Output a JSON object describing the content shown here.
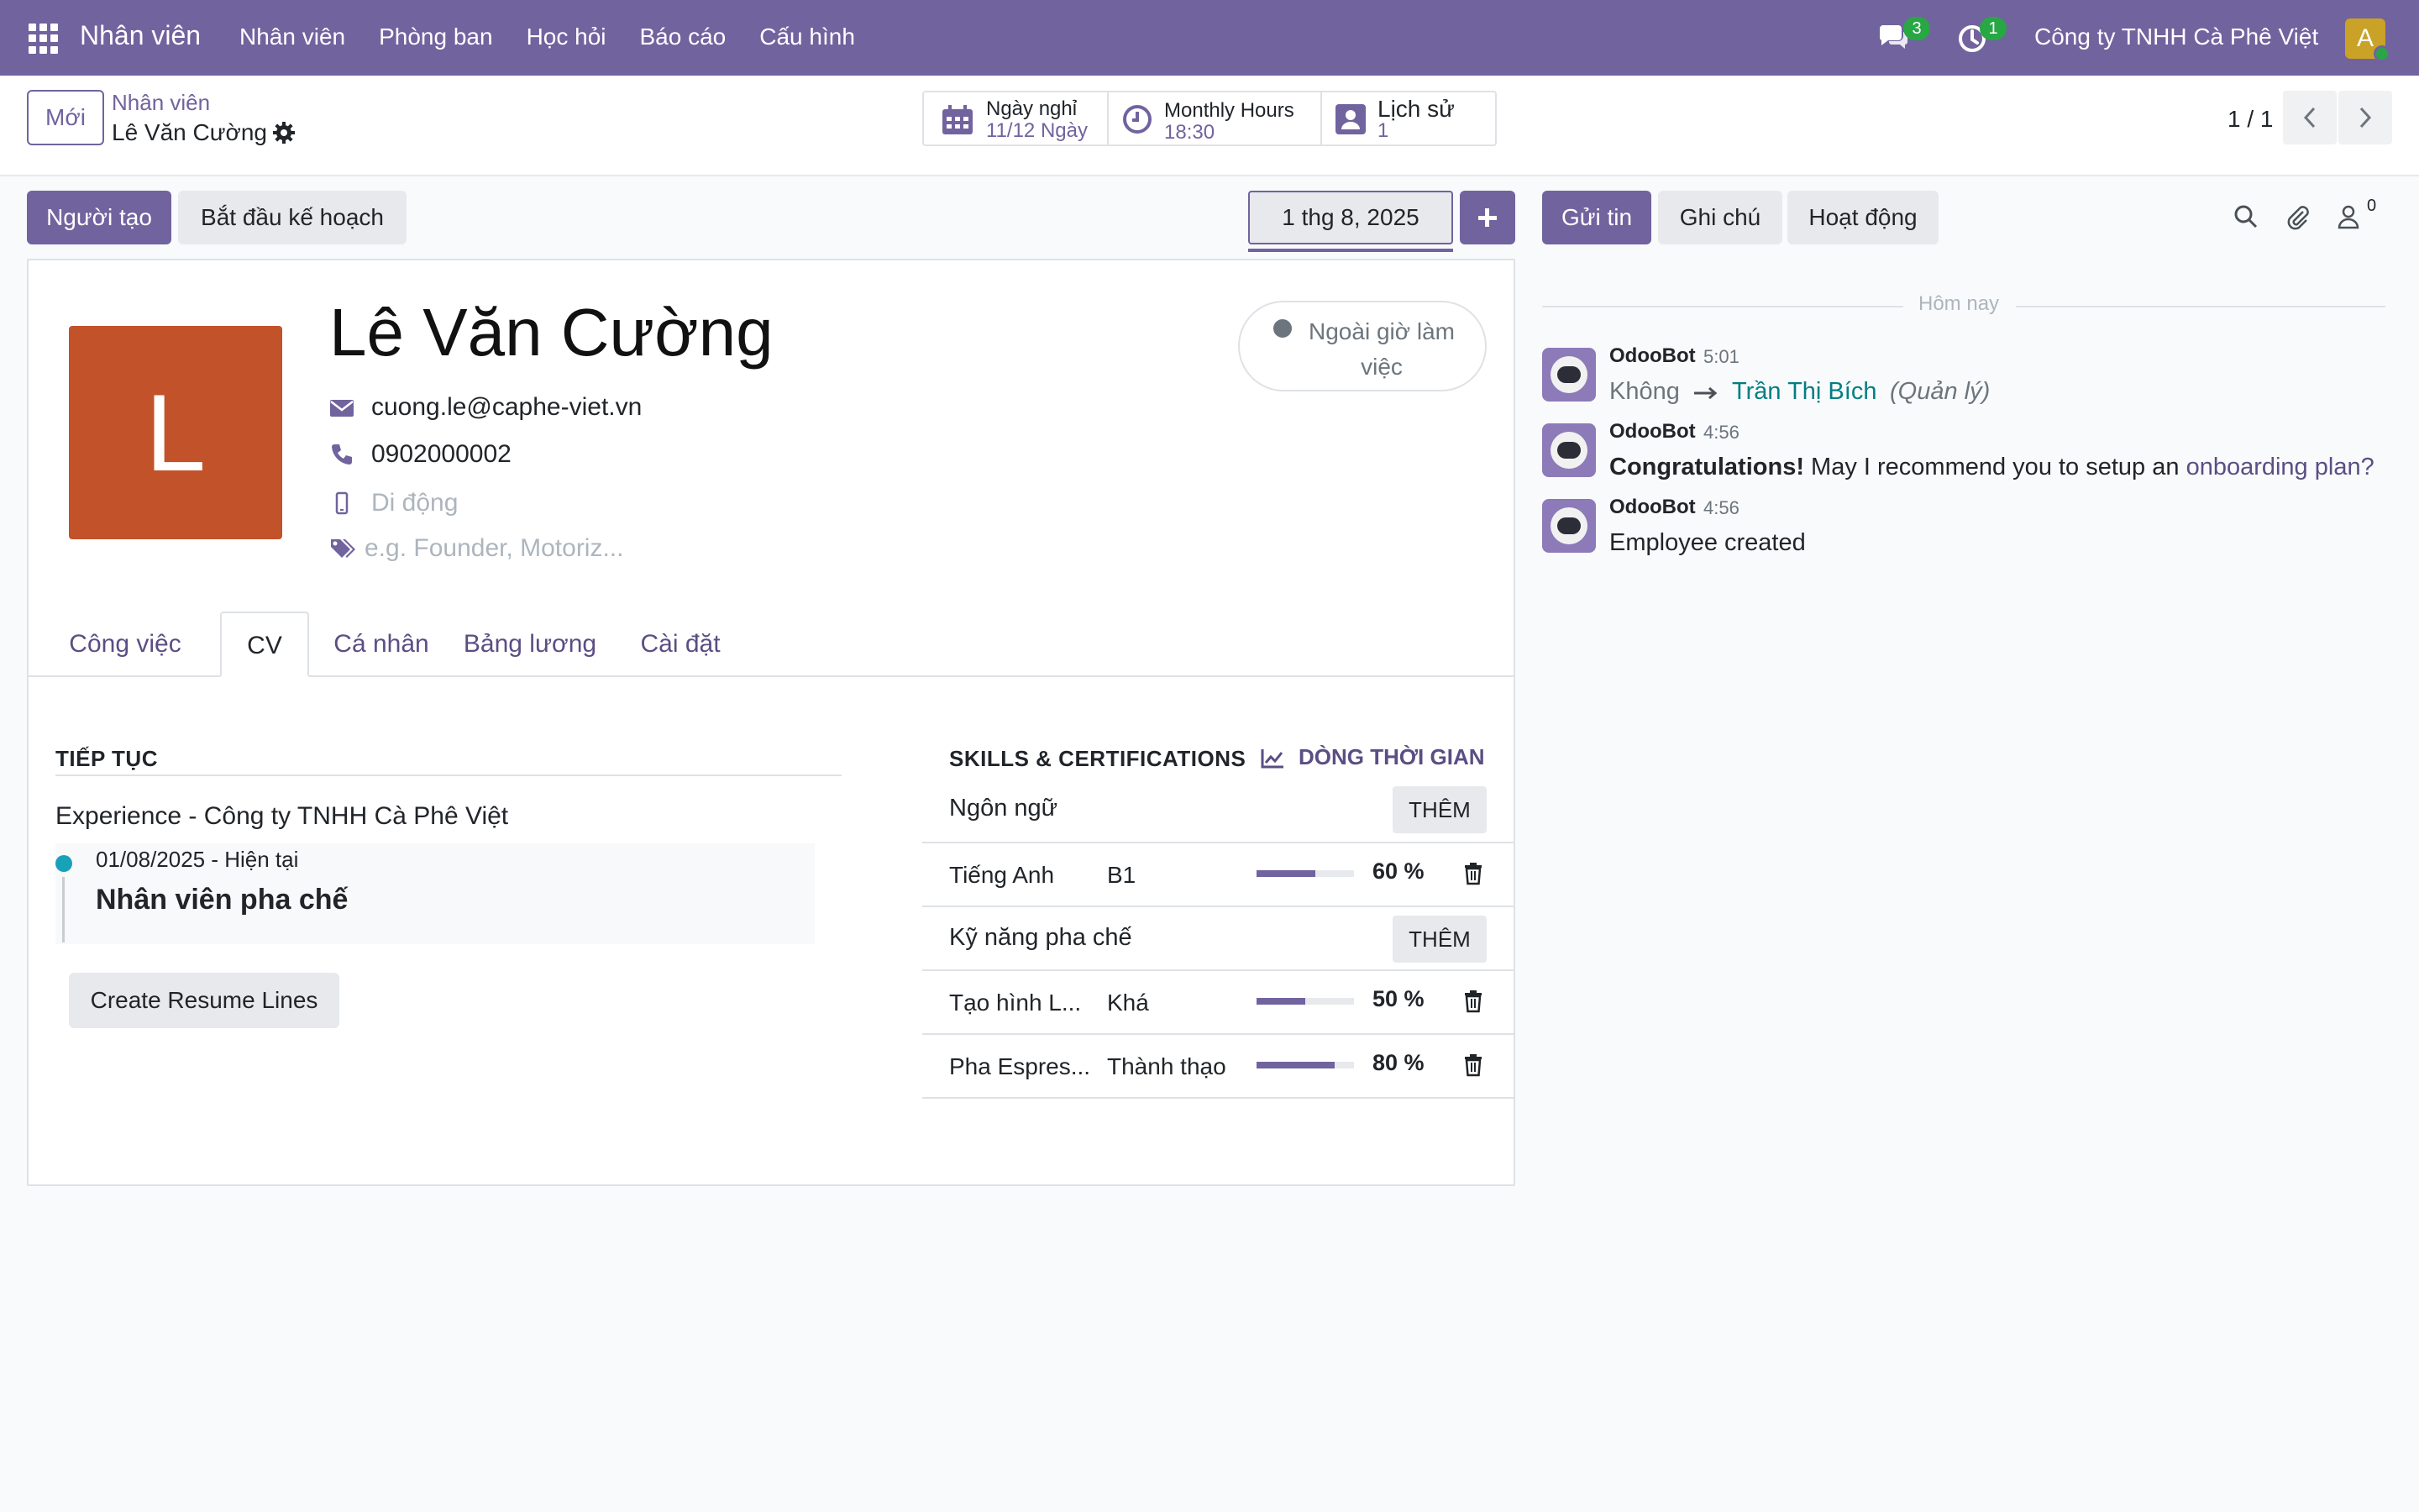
{
  "navbar": {
    "brand": "Nhân viên",
    "menu": [
      "Nhân viên",
      "Phòng ban",
      "Học hỏi",
      "Báo cáo",
      "Cấu hình"
    ],
    "chat_badge": "3",
    "activity_badge": "1",
    "company": "Công ty TNHH Cà Phê Việt",
    "user_initial": "A",
    "accent": "#71639e"
  },
  "control": {
    "new_label": "Mới",
    "breadcrumb_parent": "Nhân viên",
    "breadcrumb_current": "Lê Văn Cường",
    "smart_buttons": [
      {
        "title": "Ngày nghỉ",
        "value": "11/12 Ngày",
        "icon": "calendar-icon"
      },
      {
        "title": "Monthly Hours",
        "value": "18:30",
        "icon": "clock-icon"
      },
      {
        "title": "Lịch sử",
        "value": "1",
        "icon": "id-card-icon"
      }
    ],
    "pager": "1 / 1"
  },
  "actions": {
    "creator": "Người tạo",
    "start_plan": "Bắt đầu kế hoạch",
    "date": "1 thg 8, 2025"
  },
  "employee": {
    "initial": "L",
    "avatar_color": "#c2522a",
    "name": "Lê Văn Cường",
    "email": "cuong.le@caphe-viet.vn",
    "phone": "0902000002",
    "mobile_placeholder": "Di động",
    "tags_placeholder": "e.g. Founder, Motoriz...",
    "presence": "Ngoài giờ làm việc"
  },
  "tabs": [
    "Công việc",
    "CV",
    "Cá nhân",
    "Bảng lương",
    "Cài đặt"
  ],
  "resume": {
    "heading": "TIẾP TỤC",
    "type": "Experience - Công ty TNHH Cà Phê Việt",
    "date": "01/08/2025 - Hiện tại",
    "title": "Nhân viên pha chế",
    "create_button": "Create Resume Lines"
  },
  "skills": {
    "heading": "SKILLS & CERTIFICATIONS",
    "timeline_link": "DÒNG THỜI GIAN",
    "add_label": "THÊM",
    "groups": [
      {
        "name": "Ngôn ngữ",
        "items": [
          {
            "name": "Tiếng Anh",
            "level": "B1",
            "percent_label": "60 %",
            "progress": 0.6
          }
        ]
      },
      {
        "name": "Kỹ năng pha chế",
        "items": [
          {
            "name": "Tạo hình L...",
            "level": "Khá",
            "percent_label": "50 %",
            "progress": 0.5
          },
          {
            "name": "Pha Espres...",
            "level": "Thành thạo",
            "percent_label": "80 %",
            "progress": 0.8
          }
        ]
      }
    ]
  },
  "chatter": {
    "send": "Gửi tin",
    "note": "Ghi chú",
    "activity": "Hoạt động",
    "followers": "0",
    "today": "Hôm nay",
    "messages": [
      {
        "author": "OdooBot",
        "time": "5:01",
        "old": "Không",
        "new": "Trần Thị Bích",
        "field": "(Quản lý)"
      },
      {
        "author": "OdooBot",
        "time": "4:56",
        "bold": "Congratulations!",
        "text": " May I recommend you to setup an ",
        "link": "onboarding plan?"
      },
      {
        "author": "OdooBot",
        "time": "4:56",
        "text": "Employee created"
      }
    ]
  }
}
